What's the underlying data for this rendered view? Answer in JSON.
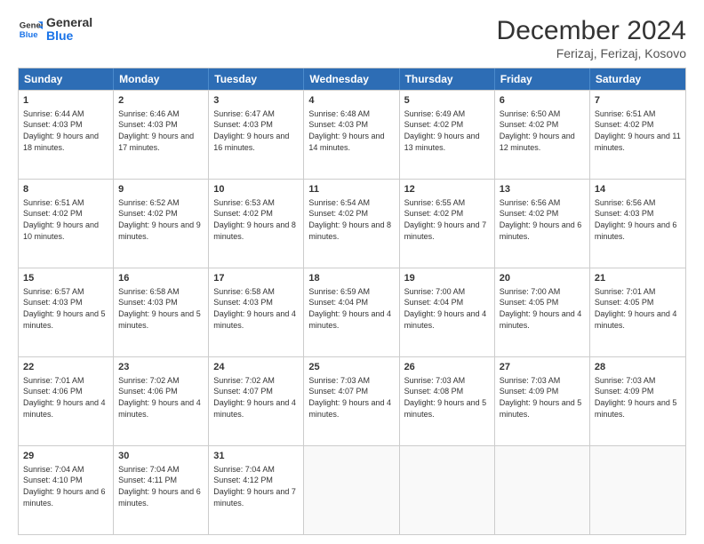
{
  "logo": {
    "line1": "General",
    "line2": "Blue"
  },
  "title": "December 2024",
  "subtitle": "Ferizaj, Ferizaj, Kosovo",
  "headers": [
    "Sunday",
    "Monday",
    "Tuesday",
    "Wednesday",
    "Thursday",
    "Friday",
    "Saturday"
  ],
  "weeks": [
    [
      {
        "day": "1",
        "text": "Sunrise: 6:44 AM\nSunset: 4:03 PM\nDaylight: 9 hours and 18 minutes."
      },
      {
        "day": "2",
        "text": "Sunrise: 6:46 AM\nSunset: 4:03 PM\nDaylight: 9 hours and 17 minutes."
      },
      {
        "day": "3",
        "text": "Sunrise: 6:47 AM\nSunset: 4:03 PM\nDaylight: 9 hours and 16 minutes."
      },
      {
        "day": "4",
        "text": "Sunrise: 6:48 AM\nSunset: 4:03 PM\nDaylight: 9 hours and 14 minutes."
      },
      {
        "day": "5",
        "text": "Sunrise: 6:49 AM\nSunset: 4:02 PM\nDaylight: 9 hours and 13 minutes."
      },
      {
        "day": "6",
        "text": "Sunrise: 6:50 AM\nSunset: 4:02 PM\nDaylight: 9 hours and 12 minutes."
      },
      {
        "day": "7",
        "text": "Sunrise: 6:51 AM\nSunset: 4:02 PM\nDaylight: 9 hours and 11 minutes."
      }
    ],
    [
      {
        "day": "8",
        "text": "Sunrise: 6:51 AM\nSunset: 4:02 PM\nDaylight: 9 hours and 10 minutes."
      },
      {
        "day": "9",
        "text": "Sunrise: 6:52 AM\nSunset: 4:02 PM\nDaylight: 9 hours and 9 minutes."
      },
      {
        "day": "10",
        "text": "Sunrise: 6:53 AM\nSunset: 4:02 PM\nDaylight: 9 hours and 8 minutes."
      },
      {
        "day": "11",
        "text": "Sunrise: 6:54 AM\nSunset: 4:02 PM\nDaylight: 9 hours and 8 minutes."
      },
      {
        "day": "12",
        "text": "Sunrise: 6:55 AM\nSunset: 4:02 PM\nDaylight: 9 hours and 7 minutes."
      },
      {
        "day": "13",
        "text": "Sunrise: 6:56 AM\nSunset: 4:02 PM\nDaylight: 9 hours and 6 minutes."
      },
      {
        "day": "14",
        "text": "Sunrise: 6:56 AM\nSunset: 4:03 PM\nDaylight: 9 hours and 6 minutes."
      }
    ],
    [
      {
        "day": "15",
        "text": "Sunrise: 6:57 AM\nSunset: 4:03 PM\nDaylight: 9 hours and 5 minutes."
      },
      {
        "day": "16",
        "text": "Sunrise: 6:58 AM\nSunset: 4:03 PM\nDaylight: 9 hours and 5 minutes."
      },
      {
        "day": "17",
        "text": "Sunrise: 6:58 AM\nSunset: 4:03 PM\nDaylight: 9 hours and 4 minutes."
      },
      {
        "day": "18",
        "text": "Sunrise: 6:59 AM\nSunset: 4:04 PM\nDaylight: 9 hours and 4 minutes."
      },
      {
        "day": "19",
        "text": "Sunrise: 7:00 AM\nSunset: 4:04 PM\nDaylight: 9 hours and 4 minutes."
      },
      {
        "day": "20",
        "text": "Sunrise: 7:00 AM\nSunset: 4:05 PM\nDaylight: 9 hours and 4 minutes."
      },
      {
        "day": "21",
        "text": "Sunrise: 7:01 AM\nSunset: 4:05 PM\nDaylight: 9 hours and 4 minutes."
      }
    ],
    [
      {
        "day": "22",
        "text": "Sunrise: 7:01 AM\nSunset: 4:06 PM\nDaylight: 9 hours and 4 minutes."
      },
      {
        "day": "23",
        "text": "Sunrise: 7:02 AM\nSunset: 4:06 PM\nDaylight: 9 hours and 4 minutes."
      },
      {
        "day": "24",
        "text": "Sunrise: 7:02 AM\nSunset: 4:07 PM\nDaylight: 9 hours and 4 minutes."
      },
      {
        "day": "25",
        "text": "Sunrise: 7:03 AM\nSunset: 4:07 PM\nDaylight: 9 hours and 4 minutes."
      },
      {
        "day": "26",
        "text": "Sunrise: 7:03 AM\nSunset: 4:08 PM\nDaylight: 9 hours and 5 minutes."
      },
      {
        "day": "27",
        "text": "Sunrise: 7:03 AM\nSunset: 4:09 PM\nDaylight: 9 hours and 5 minutes."
      },
      {
        "day": "28",
        "text": "Sunrise: 7:03 AM\nSunset: 4:09 PM\nDaylight: 9 hours and 5 minutes."
      }
    ],
    [
      {
        "day": "29",
        "text": "Sunrise: 7:04 AM\nSunset: 4:10 PM\nDaylight: 9 hours and 6 minutes."
      },
      {
        "day": "30",
        "text": "Sunrise: 7:04 AM\nSunset: 4:11 PM\nDaylight: 9 hours and 6 minutes."
      },
      {
        "day": "31",
        "text": "Sunrise: 7:04 AM\nSunset: 4:12 PM\nDaylight: 9 hours and 7 minutes."
      },
      {
        "day": "",
        "text": ""
      },
      {
        "day": "",
        "text": ""
      },
      {
        "day": "",
        "text": ""
      },
      {
        "day": "",
        "text": ""
      }
    ]
  ]
}
